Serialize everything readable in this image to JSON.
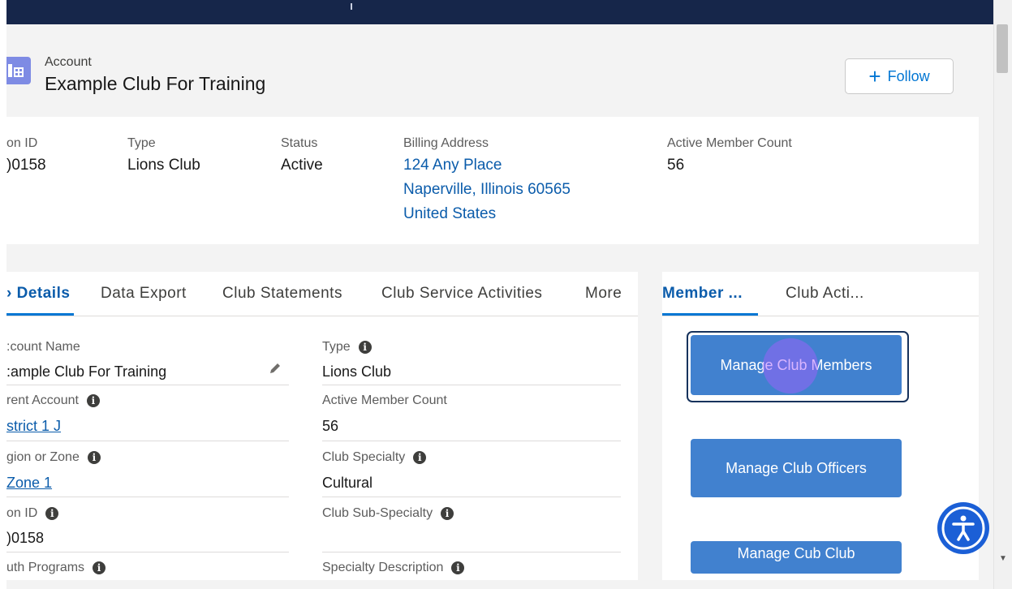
{
  "header": {
    "object_label": "Account",
    "record_name": "Example Club For Training",
    "follow_label": "Follow"
  },
  "highlights": [
    {
      "label": "on ID",
      "value": ")0158"
    },
    {
      "label": "Type",
      "value": "Lions Club"
    },
    {
      "label": "Status",
      "value": "Active"
    },
    {
      "label": "Billing Address",
      "lines": [
        "124 Any Place",
        "Naperville, Illinois 60565",
        "United States"
      ]
    },
    {
      "label": "Active Member Count",
      "value": "56"
    }
  ],
  "left_tabs": [
    {
      "label": "› Details",
      "active": true
    },
    {
      "label": "Data Export"
    },
    {
      "label": "Club Statements"
    },
    {
      "label": "Club Service Activities"
    },
    {
      "label": "More"
    }
  ],
  "fields_left": [
    {
      "label": ":count Name",
      "value": ":ample Club For Training"
    },
    {
      "label": "rent Account",
      "value": "strict 1 J"
    },
    {
      "label": "gion or Zone",
      "value": "Zone 1"
    },
    {
      "label": "on ID",
      "value": ")0158"
    },
    {
      "label": "uth Programs"
    }
  ],
  "fields_right": [
    {
      "label": "Type",
      "value": "Lions Club"
    },
    {
      "label": "Active Member Count",
      "value": "56"
    },
    {
      "label": "Club Specialty",
      "value": "Cultural"
    },
    {
      "label": "Club Sub-Specialty",
      "value": ""
    },
    {
      "label": "Specialty Description"
    }
  ],
  "right_tabs": [
    {
      "label": "Member ...",
      "active": true
    },
    {
      "label": "Club Acti..."
    }
  ],
  "actions": {
    "manage_members": "Manage Club Members",
    "manage_officers": "Manage Club Officers",
    "manage_cub": "Manage Cub Club"
  },
  "colors": {
    "header_bar": "#16264a",
    "link": "#0b5cab",
    "button_blue": "#4181cf",
    "account_icon": "#7e8be4",
    "accessibility_button": "#1b5fd6"
  },
  "icons": [
    "account-icon",
    "plus-icon",
    "info-icon",
    "pencil-icon",
    "accessibility-icon"
  ]
}
